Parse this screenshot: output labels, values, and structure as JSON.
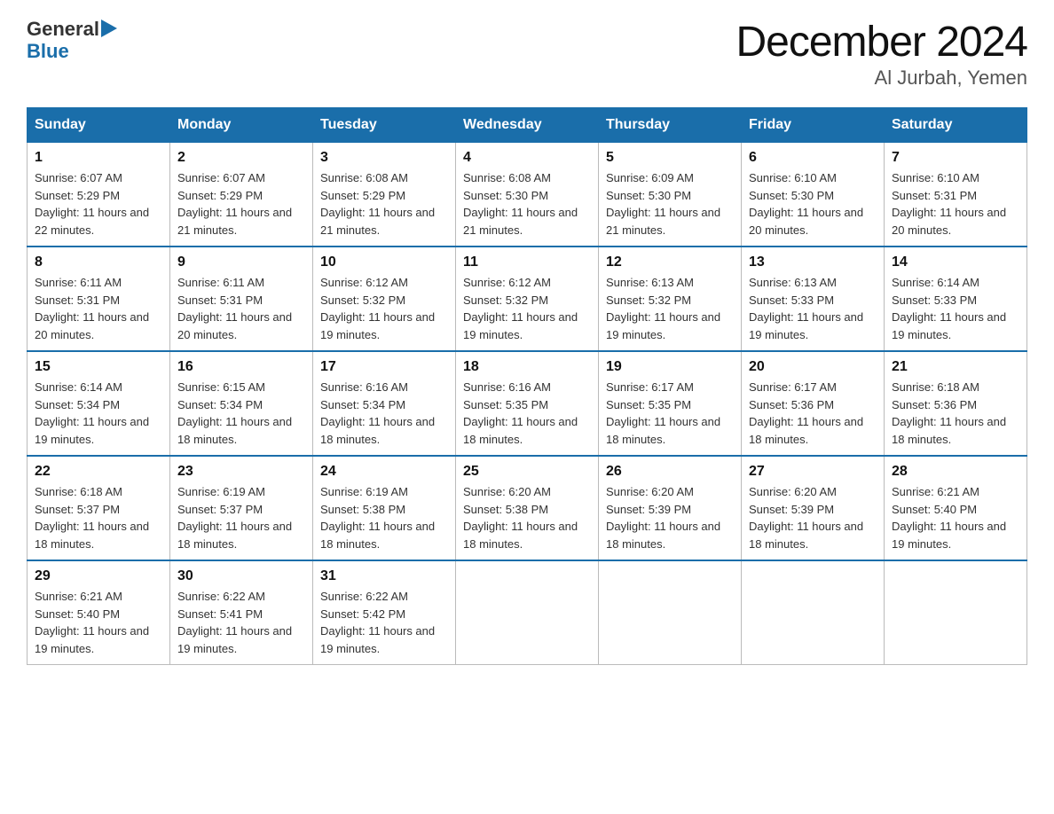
{
  "logo": {
    "general": "General",
    "blue": "Blue"
  },
  "title": "December 2024",
  "subtitle": "Al Jurbah, Yemen",
  "days_of_week": [
    "Sunday",
    "Monday",
    "Tuesday",
    "Wednesday",
    "Thursday",
    "Friday",
    "Saturday"
  ],
  "weeks": [
    [
      {
        "day": "1",
        "sunrise": "6:07 AM",
        "sunset": "5:29 PM",
        "daylight": "11 hours and 22 minutes."
      },
      {
        "day": "2",
        "sunrise": "6:07 AM",
        "sunset": "5:29 PM",
        "daylight": "11 hours and 21 minutes."
      },
      {
        "day": "3",
        "sunrise": "6:08 AM",
        "sunset": "5:29 PM",
        "daylight": "11 hours and 21 minutes."
      },
      {
        "day": "4",
        "sunrise": "6:08 AM",
        "sunset": "5:30 PM",
        "daylight": "11 hours and 21 minutes."
      },
      {
        "day": "5",
        "sunrise": "6:09 AM",
        "sunset": "5:30 PM",
        "daylight": "11 hours and 21 minutes."
      },
      {
        "day": "6",
        "sunrise": "6:10 AM",
        "sunset": "5:30 PM",
        "daylight": "11 hours and 20 minutes."
      },
      {
        "day": "7",
        "sunrise": "6:10 AM",
        "sunset": "5:31 PM",
        "daylight": "11 hours and 20 minutes."
      }
    ],
    [
      {
        "day": "8",
        "sunrise": "6:11 AM",
        "sunset": "5:31 PM",
        "daylight": "11 hours and 20 minutes."
      },
      {
        "day": "9",
        "sunrise": "6:11 AM",
        "sunset": "5:31 PM",
        "daylight": "11 hours and 20 minutes."
      },
      {
        "day": "10",
        "sunrise": "6:12 AM",
        "sunset": "5:32 PM",
        "daylight": "11 hours and 19 minutes."
      },
      {
        "day": "11",
        "sunrise": "6:12 AM",
        "sunset": "5:32 PM",
        "daylight": "11 hours and 19 minutes."
      },
      {
        "day": "12",
        "sunrise": "6:13 AM",
        "sunset": "5:32 PM",
        "daylight": "11 hours and 19 minutes."
      },
      {
        "day": "13",
        "sunrise": "6:13 AM",
        "sunset": "5:33 PM",
        "daylight": "11 hours and 19 minutes."
      },
      {
        "day": "14",
        "sunrise": "6:14 AM",
        "sunset": "5:33 PM",
        "daylight": "11 hours and 19 minutes."
      }
    ],
    [
      {
        "day": "15",
        "sunrise": "6:14 AM",
        "sunset": "5:34 PM",
        "daylight": "11 hours and 19 minutes."
      },
      {
        "day": "16",
        "sunrise": "6:15 AM",
        "sunset": "5:34 PM",
        "daylight": "11 hours and 18 minutes."
      },
      {
        "day": "17",
        "sunrise": "6:16 AM",
        "sunset": "5:34 PM",
        "daylight": "11 hours and 18 minutes."
      },
      {
        "day": "18",
        "sunrise": "6:16 AM",
        "sunset": "5:35 PM",
        "daylight": "11 hours and 18 minutes."
      },
      {
        "day": "19",
        "sunrise": "6:17 AM",
        "sunset": "5:35 PM",
        "daylight": "11 hours and 18 minutes."
      },
      {
        "day": "20",
        "sunrise": "6:17 AM",
        "sunset": "5:36 PM",
        "daylight": "11 hours and 18 minutes."
      },
      {
        "day": "21",
        "sunrise": "6:18 AM",
        "sunset": "5:36 PM",
        "daylight": "11 hours and 18 minutes."
      }
    ],
    [
      {
        "day": "22",
        "sunrise": "6:18 AM",
        "sunset": "5:37 PM",
        "daylight": "11 hours and 18 minutes."
      },
      {
        "day": "23",
        "sunrise": "6:19 AM",
        "sunset": "5:37 PM",
        "daylight": "11 hours and 18 minutes."
      },
      {
        "day": "24",
        "sunrise": "6:19 AM",
        "sunset": "5:38 PM",
        "daylight": "11 hours and 18 minutes."
      },
      {
        "day": "25",
        "sunrise": "6:20 AM",
        "sunset": "5:38 PM",
        "daylight": "11 hours and 18 minutes."
      },
      {
        "day": "26",
        "sunrise": "6:20 AM",
        "sunset": "5:39 PM",
        "daylight": "11 hours and 18 minutes."
      },
      {
        "day": "27",
        "sunrise": "6:20 AM",
        "sunset": "5:39 PM",
        "daylight": "11 hours and 18 minutes."
      },
      {
        "day": "28",
        "sunrise": "6:21 AM",
        "sunset": "5:40 PM",
        "daylight": "11 hours and 19 minutes."
      }
    ],
    [
      {
        "day": "29",
        "sunrise": "6:21 AM",
        "sunset": "5:40 PM",
        "daylight": "11 hours and 19 minutes."
      },
      {
        "day": "30",
        "sunrise": "6:22 AM",
        "sunset": "5:41 PM",
        "daylight": "11 hours and 19 minutes."
      },
      {
        "day": "31",
        "sunrise": "6:22 AM",
        "sunset": "5:42 PM",
        "daylight": "11 hours and 19 minutes."
      },
      null,
      null,
      null,
      null
    ]
  ]
}
